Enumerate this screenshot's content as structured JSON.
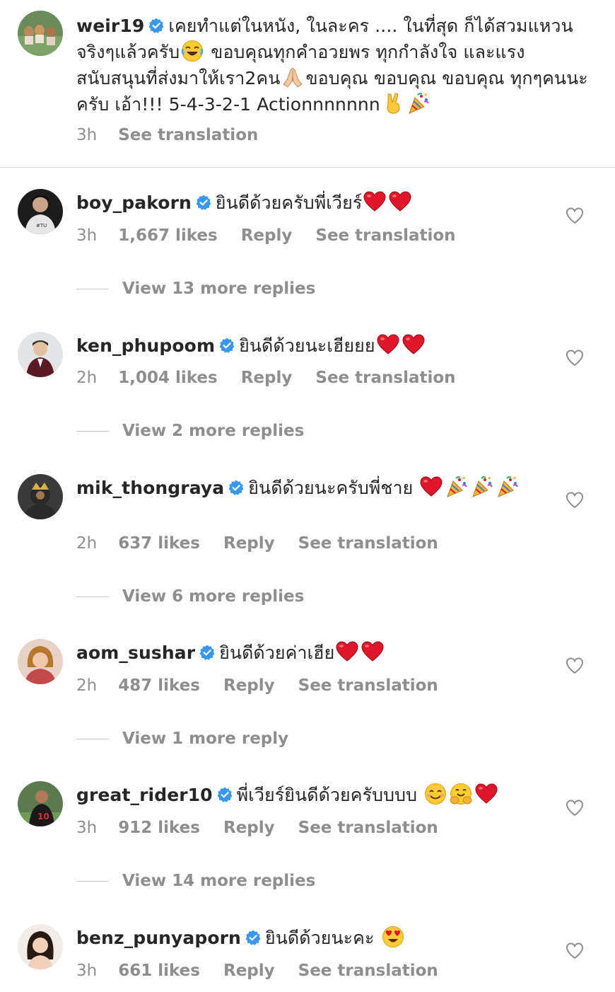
{
  "caption": {
    "username": "weir19",
    "text_1": "เคยทำแต่ในหนัง, ในละคร .... ในที่สุด ก็ได้สวมแหวนจริงๆแล้วครับ",
    "text_2": " ขอบคุณทุกคำอวยพร ทุกกำลังใจ และแรงสนับสนุนที่ส่งมาให้เรา2คน",
    "text_3": "ขอบคุณ ขอบคุณ ขอบคุณ ทุกๆคนนะครับ เอ้า!!! 5-4-3-2-1 Actionnnnnnn",
    "time": "3h",
    "see_translation": "See translation"
  },
  "comments": [
    {
      "username": "boy_pakorn",
      "text": "ยินดีด้วยครับพี่เวียร์",
      "time": "3h",
      "likes": "1,667 likes",
      "reply": "Reply",
      "see_translation": "See translation",
      "view_replies": "View 13 more replies"
    },
    {
      "username": "ken_phupoom",
      "text": "ยินดีด้วยนะเฮียยย",
      "time": "2h",
      "likes": "1,004 likes",
      "reply": "Reply",
      "see_translation": "See translation",
      "view_replies": "View 2 more replies"
    },
    {
      "username": "mik_thongraya",
      "text": "ยินดีด้วยนะครับพี่ชาย ",
      "time": "2h",
      "likes": "637 likes",
      "reply": "Reply",
      "see_translation": "See translation",
      "view_replies": "View 6 more replies"
    },
    {
      "username": "aom_sushar",
      "text": "ยินดีด้วยค่าเฮีย",
      "time": "2h",
      "likes": "487 likes",
      "reply": "Reply",
      "see_translation": "See translation",
      "view_replies": "View 1 more reply"
    },
    {
      "username": "great_rider10",
      "text": "พี่เวียร์ยินดีด้วยครับบบบ ",
      "time": "3h",
      "likes": "912 likes",
      "reply": "Reply",
      "see_translation": "See translation",
      "view_replies": "View 14 more replies"
    },
    {
      "username": "benz_punyaporn",
      "text": "ยินดีด้วยนะคะ ",
      "time": "3h",
      "likes": "661 likes",
      "reply": "Reply",
      "see_translation": "See translation"
    }
  ],
  "icons": {
    "verified": "verified-badge-icon",
    "heart": "heart-outline-icon",
    "red_heart": "red-heart-emoji",
    "party": "party-popper-emoji",
    "laugh": "tears-of-joy-emoji",
    "pray": "folded-hands-emoji",
    "victory": "victory-hand-emoji",
    "smile": "smiling-face-emoji",
    "hug": "hugging-face-emoji",
    "heart_eyes": "heart-eyes-emoji"
  },
  "colors": {
    "text": "#262626",
    "secondary": "#8e8e8e",
    "verified_blue": "#3897f0",
    "emoji_red": "#e0162b",
    "divider": "#dbdbdb"
  }
}
